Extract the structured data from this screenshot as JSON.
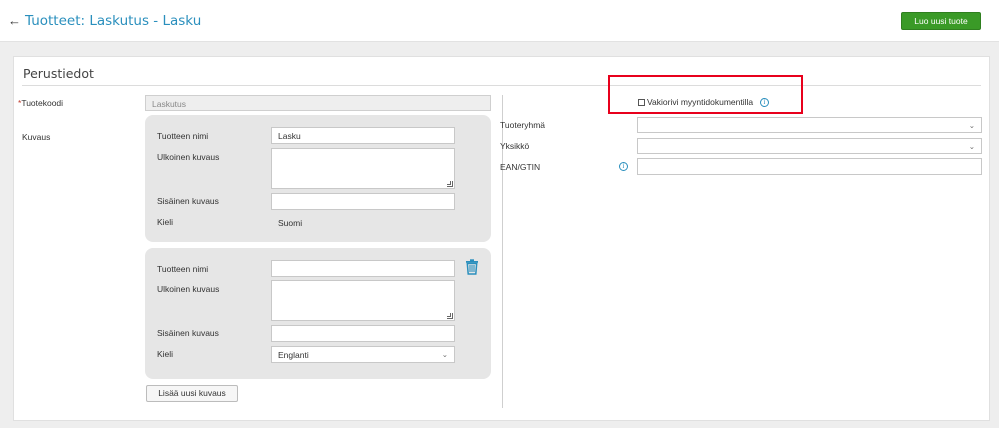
{
  "header": {
    "back_icon": "arrow-left-icon",
    "title": "Tuotteet: Laskutus - Lasku",
    "new_button": "Luo uusi tuote",
    "new_button_color": "#3a9a27",
    "title_color": "#2a8fbd"
  },
  "section": {
    "title": "Perustiedot"
  },
  "left": {
    "code_required_mark": "*",
    "code_label": "Tuotekoodi",
    "code_value": "Laskutus",
    "description_label": "Kuvaus",
    "add_description_button": "Lisää uusi kuvaus"
  },
  "descriptions": [
    {
      "name_label": "Tuotteen nimi",
      "name_value": "Lasku",
      "external_label": "Ulkoinen kuvaus",
      "external_value": "",
      "internal_label": "Sisäinen kuvaus",
      "internal_value": "",
      "language_label": "Kieli",
      "language_value": "Suomi"
    },
    {
      "name_label": "Tuotteen nimi",
      "name_value": "",
      "external_label": "Ulkoinen kuvaus",
      "external_value": "",
      "internal_label": "Sisäinen kuvaus",
      "internal_value": "",
      "language_label": "Kieli",
      "language_value": "Englanti",
      "delete_icon": "trash-icon"
    }
  ],
  "right": {
    "standard_row_checkbox_label": "Vakiorivi myyntidokumentilla",
    "standard_row_checked": false,
    "product_group_label": "Tuoteryhmä",
    "product_group_value": "",
    "unit_label": "Yksikkö",
    "unit_value": "",
    "ean_label": "EAN/GTIN",
    "ean_value": ""
  },
  "annotation": {
    "highlight_color": "#e8001c"
  }
}
